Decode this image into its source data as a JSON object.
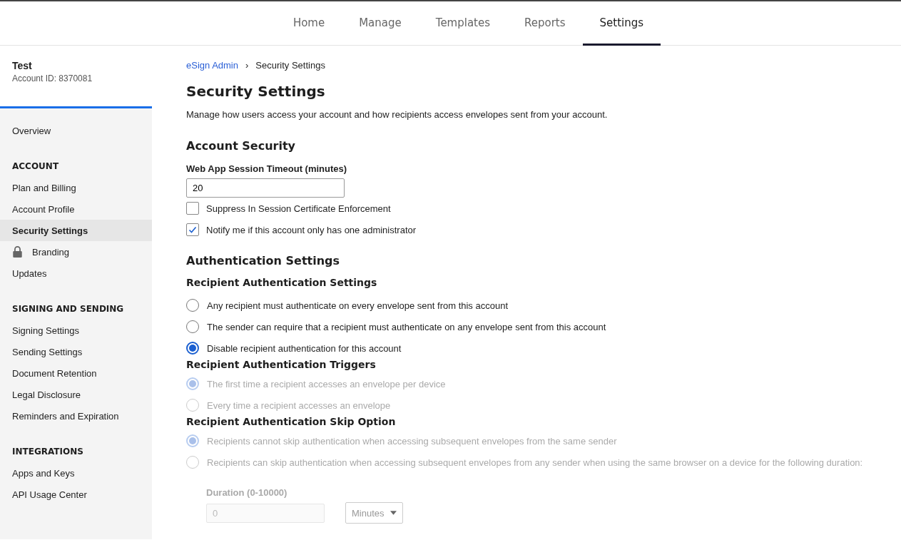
{
  "nav": {
    "tabs": [
      {
        "label": "Home",
        "selected": false
      },
      {
        "label": "Manage",
        "selected": false
      },
      {
        "label": "Templates",
        "selected": false
      },
      {
        "label": "Reports",
        "selected": false
      },
      {
        "label": "Settings",
        "selected": true
      }
    ]
  },
  "sidebar": {
    "account_name": "Test",
    "account_id": "Account ID: 8370081",
    "items": [
      {
        "label": "Overview",
        "selected": false,
        "locked": false
      }
    ],
    "groups": [
      {
        "heading": "ACCOUNT",
        "items": [
          {
            "label": "Plan and Billing",
            "selected": false,
            "locked": false
          },
          {
            "label": "Account Profile",
            "selected": false,
            "locked": false
          },
          {
            "label": "Security Settings",
            "selected": true,
            "locked": false
          },
          {
            "label": "Branding",
            "selected": false,
            "locked": true
          },
          {
            "label": "Updates",
            "selected": false,
            "locked": false
          }
        ]
      },
      {
        "heading": "SIGNING AND SENDING",
        "items": [
          {
            "label": "Signing Settings",
            "selected": false,
            "locked": false
          },
          {
            "label": "Sending Settings",
            "selected": false,
            "locked": false
          },
          {
            "label": "Document Retention",
            "selected": false,
            "locked": false
          },
          {
            "label": "Legal Disclosure",
            "selected": false,
            "locked": false
          },
          {
            "label": "Reminders and Expiration",
            "selected": false,
            "locked": false
          }
        ]
      },
      {
        "heading": "INTEGRATIONS",
        "items": [
          {
            "label": "Apps and Keys",
            "selected": false,
            "locked": false
          },
          {
            "label": "API Usage Center",
            "selected": false,
            "locked": false
          }
        ]
      }
    ]
  },
  "breadcrumb": {
    "link": "eSign Admin",
    "separator": "›",
    "current": "Security Settings"
  },
  "title": "Security Settings",
  "description": "Manage how users access your account and how recipients access envelopes sent from your account.",
  "account_security": {
    "heading": "Account Security",
    "timeout_label": "Web App Session Timeout (minutes)",
    "timeout_value": "20",
    "checkboxes": [
      {
        "label": "Suppress In Session Certificate Enforcement",
        "checked": false
      },
      {
        "label": "Notify me if this account only has one administrator",
        "checked": true
      }
    ]
  },
  "authentication": {
    "heading": "Authentication Settings",
    "groups": [
      {
        "heading": "Recipient Authentication Settings",
        "options": [
          {
            "label": "Any recipient must authenticate on every envelope sent from this account",
            "selected": false,
            "disabled": false
          },
          {
            "label": "The sender can require that a recipient must authenticate on any envelope sent from this account",
            "selected": false,
            "disabled": false
          },
          {
            "label": "Disable recipient authentication for this account",
            "selected": true,
            "disabled": false
          }
        ]
      },
      {
        "heading": "Recipient Authentication Triggers",
        "options": [
          {
            "label": "The first time a recipient accesses an envelope per device",
            "selected": true,
            "disabled": true
          },
          {
            "label": "Every time a recipient accesses an envelope",
            "selected": false,
            "disabled": true
          }
        ]
      },
      {
        "heading": "Recipient Authentication Skip Option",
        "options": [
          {
            "label": "Recipients cannot skip authentication when accessing subsequent envelopes from the same sender",
            "selected": true,
            "disabled": true
          },
          {
            "label": "Recipients can skip authentication when accessing subsequent envelopes from any sender when using the same browser on a device for the following duration:",
            "selected": false,
            "disabled": true
          }
        ]
      }
    ],
    "duration": {
      "label": "Duration (0-10000)",
      "value": "0",
      "unit": "Minutes",
      "disabled": true
    }
  }
}
